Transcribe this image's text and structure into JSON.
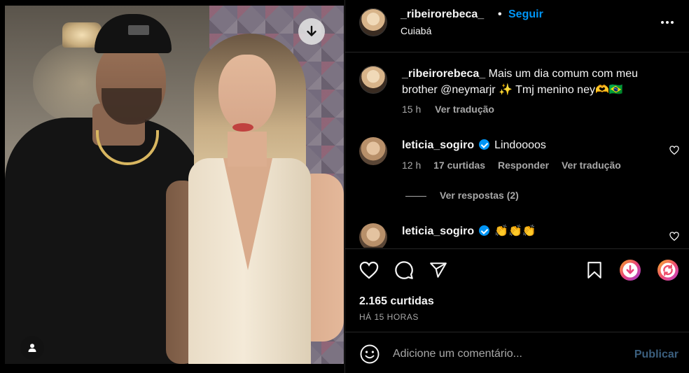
{
  "post": {
    "author": "_ribeirorebeca_",
    "follow_label": "Seguir",
    "separator": "•",
    "location": "Cuiabá",
    "more_label": "•••"
  },
  "caption": {
    "username": "_ribeirorebeca_",
    "text": "Mais um dia comum com meu brother @neymarjr ✨ Tmj menino ney🫶🇧🇷",
    "time": "15 h",
    "translate_label": "Ver tradução"
  },
  "comments": [
    {
      "username": "leticia_sogiro",
      "verified": true,
      "text": "Lindoooos",
      "time": "12 h",
      "likes": "17 curtidas",
      "reply_label": "Responder",
      "translate_label": "Ver tradução",
      "replies_label": "Ver respostas (2)"
    },
    {
      "username": "leticia_sogiro",
      "verified": true,
      "text": "👏👏👏"
    }
  ],
  "stats": {
    "likes": "2.165 curtidas",
    "time_ago": "HÁ 15 HORAS"
  },
  "composer": {
    "placeholder": "Adicione um comentário...",
    "publish_label": "Publicar"
  },
  "colors": {
    "background": "#000000",
    "accent": "#0095f6",
    "muted": "#a8a8a8",
    "publish_disabled": "#3b5f7e"
  }
}
